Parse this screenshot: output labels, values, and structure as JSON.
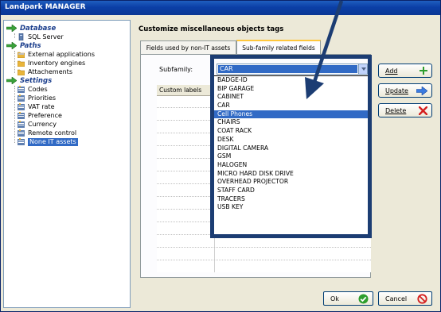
{
  "window": {
    "title": "Landpark MANAGER"
  },
  "sidebar": {
    "items": [
      {
        "label": "Database",
        "type": "section",
        "expanded": true
      },
      {
        "label": "SQL Server",
        "type": "child",
        "icon": "database-icon"
      },
      {
        "label": "Paths",
        "type": "section",
        "expanded": true
      },
      {
        "label": "External applications",
        "type": "child",
        "icon": "folder-icon"
      },
      {
        "label": "Inventory engines",
        "type": "child",
        "icon": "folder-icon"
      },
      {
        "label": "Attachements",
        "type": "child",
        "icon": "folder-icon"
      },
      {
        "label": "Settings",
        "type": "section",
        "expanded": true
      },
      {
        "label": "Codes",
        "type": "child",
        "icon": "settings-list-icon"
      },
      {
        "label": "Priorities",
        "type": "child",
        "icon": "settings-list-icon"
      },
      {
        "label": "VAT rate",
        "type": "child",
        "icon": "settings-list-icon"
      },
      {
        "label": "Preference",
        "type": "child",
        "icon": "settings-list-icon"
      },
      {
        "label": "Currency",
        "type": "child",
        "icon": "settings-list-icon"
      },
      {
        "label": "Remote control",
        "type": "child",
        "icon": "settings-list-icon"
      },
      {
        "label": "None IT assets",
        "type": "child",
        "icon": "settings-list-icon",
        "selected": true
      }
    ]
  },
  "main": {
    "title": "Customize miscellaneous objects tags",
    "tabs": [
      {
        "label": "Fields used by non-IT assets",
        "active": false
      },
      {
        "label": "Sub-family related fields",
        "active": true
      }
    ],
    "subfamily_label": "Subfamily:",
    "subfamily_value": "CAR",
    "grid_header": "Custom labels",
    "dropdown_options": [
      "BADGE-ID",
      "BIP GARAGE",
      "CABINET",
      "CAR",
      "Cell Phones",
      "CHAIRS",
      "COAT RACK",
      "DESK",
      "DIGITAL CAMERA",
      "GSM",
      "HALOGEN",
      "MICRO HARD DISK DRIVE",
      "OVERHEAD PROJECTOR",
      "STAFF CARD",
      "TRACERS",
      "USB KEY"
    ],
    "dropdown_selected_index": 4
  },
  "buttons": {
    "add": "Add",
    "update": "Update",
    "delete": "Delete",
    "ok": "Ok",
    "cancel": "Cancel"
  },
  "colors": {
    "section_text": "#1b3e8c",
    "selection": "#316ac5",
    "highlight_frame": "#1c3d73",
    "add_icon": "#2e9e2e",
    "delete_icon": "#d42020"
  }
}
